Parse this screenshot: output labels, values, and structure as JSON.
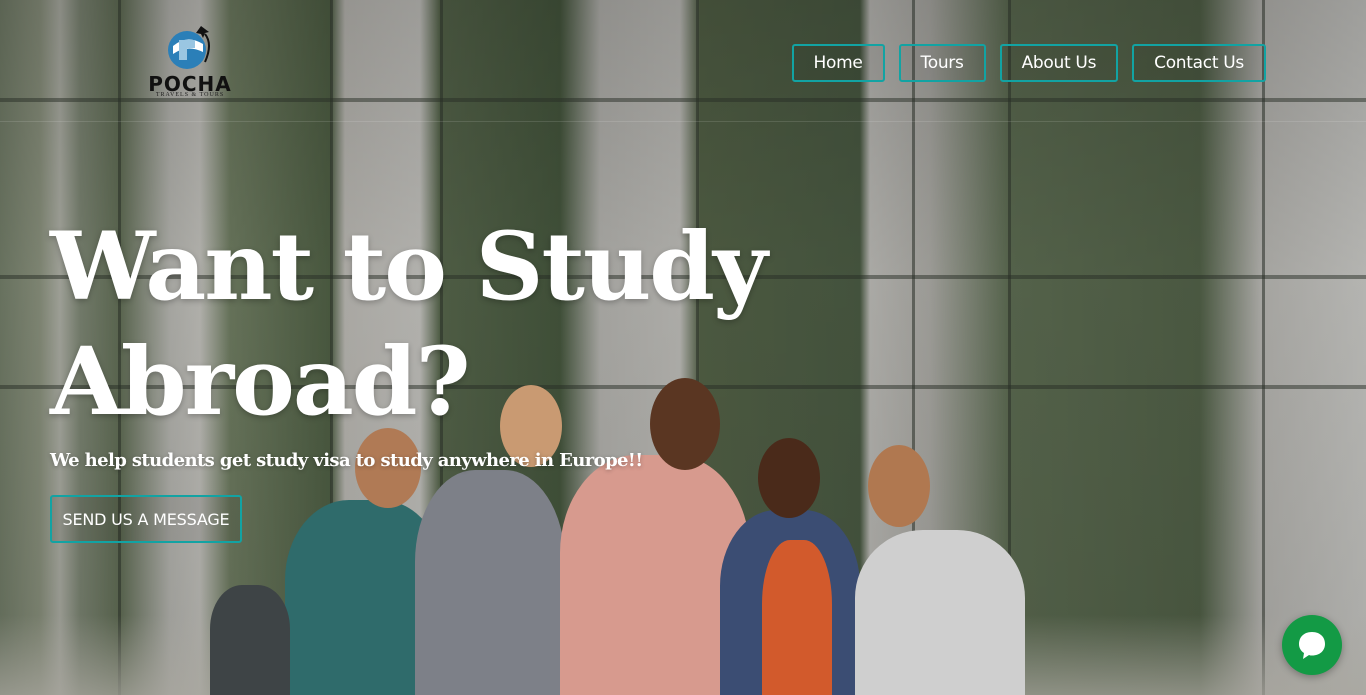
{
  "brand": {
    "name": "POCHA",
    "tagline": "TRAVELS & TOURS",
    "logo_icon": "globe-plane-icon"
  },
  "nav": {
    "items": [
      {
        "label": "Home"
      },
      {
        "label": "Tours"
      },
      {
        "label": "About Us"
      },
      {
        "label": "Contact Us"
      }
    ],
    "border_color": "#12a3a3"
  },
  "hero": {
    "headline": "Want to Study Abroad?",
    "subheadline": "We help students get study visa to study anywhere in Europe!!",
    "cta_label": "SEND US A MESSAGE",
    "background_image": "students-in-front-of-glass-building"
  },
  "chat_widget": {
    "icon": "chat-bubble-icon",
    "color": "#139a45"
  }
}
